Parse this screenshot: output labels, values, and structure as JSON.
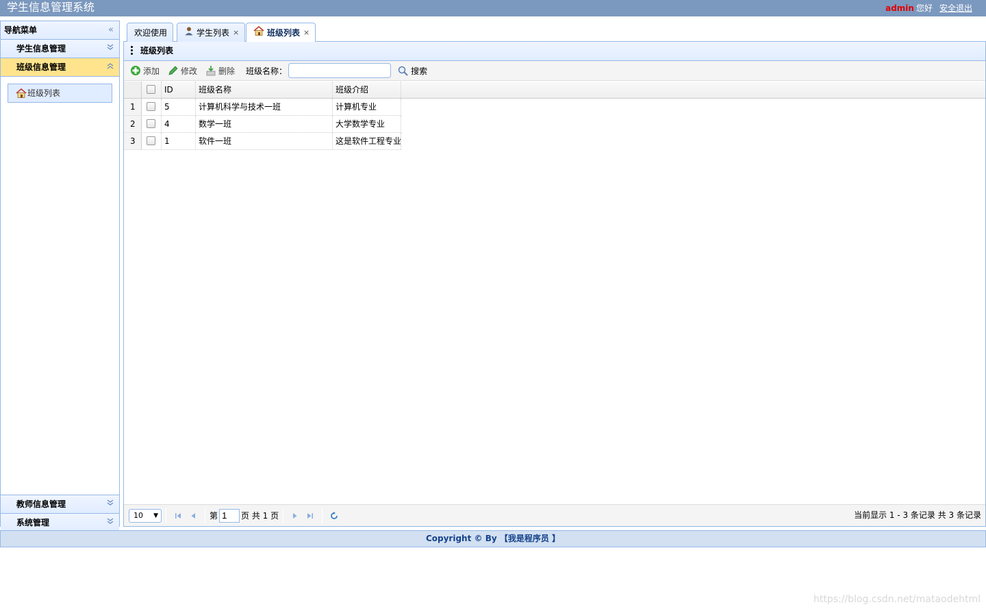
{
  "header": {
    "title": "学生信息管理系统",
    "user": "admin",
    "greeting": "您好",
    "logout": "安全退出"
  },
  "sidebar": {
    "title": "导航菜单",
    "collapse_icon": "double-chevron-left-icon",
    "sections": [
      {
        "label": "学生信息管理",
        "expanded": false
      },
      {
        "label": "班级信息管理",
        "expanded": true,
        "items": [
          {
            "label": "班级列表",
            "icon": "home-icon"
          }
        ]
      },
      {
        "label": "教师信息管理",
        "expanded": false
      },
      {
        "label": "系统管理",
        "expanded": false
      }
    ]
  },
  "tabs": [
    {
      "label": "欢迎使用",
      "closable": false
    },
    {
      "label": "学生列表",
      "closable": true,
      "icon": "user-icon"
    },
    {
      "label": "班级列表",
      "closable": true,
      "icon": "home-icon",
      "selected": true
    }
  ],
  "tab_close": "×",
  "panel": {
    "title": "班级列表"
  },
  "toolbar": {
    "add_label": "添加",
    "edit_label": "修改",
    "delete_label": "删除",
    "search_label": "班级名称：",
    "search_value": "",
    "search_button": "搜索"
  },
  "grid": {
    "columns": [
      "ID",
      "班级名称",
      "班级介绍"
    ],
    "rows": [
      {
        "num": "1",
        "id": "5",
        "name": "计算机科学与技术一班",
        "intro": "计算机专业"
      },
      {
        "num": "2",
        "id": "4",
        "name": "数学一班",
        "intro": "大学数学专业"
      },
      {
        "num": "3",
        "id": "1",
        "name": "软件一班",
        "intro": "这是软件工程专业"
      }
    ]
  },
  "pager": {
    "page_size": "10",
    "page_prefix": "第",
    "page_value": "1",
    "page_suffix": "页 共 1 页",
    "info": "当前显示 1 - 3 条记录 共 3 条记录"
  },
  "footer": {
    "text": "Copyright © By 【我是程序员 】"
  },
  "watermark": "https://blog.csdn.net/mataodehtml",
  "colors": {
    "header_bg": "#7b98be",
    "accent_border": "#95b8e7",
    "active_section": "#ffe48d",
    "user_red": "#e00000"
  }
}
